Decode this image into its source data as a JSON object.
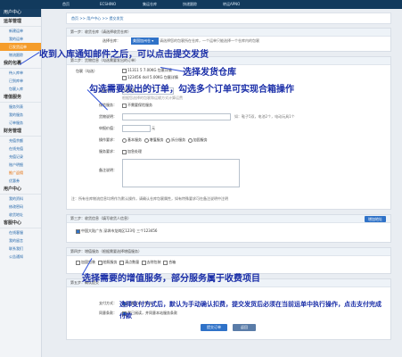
{
  "topnav": {
    "items": [
      "首页",
      "ECSHINO",
      "集运仓库",
      "快递跟踪",
      "转运APNO"
    ]
  },
  "sidebar": {
    "title": "用户中心",
    "sections": [
      {
        "name": "运单管理",
        "items": [
          "新建运单",
          "我的运单",
          "已发货运单",
          "物流跟踪"
        ]
      },
      {
        "name": "我的包裹",
        "items": [
          "待入库单",
          "已到库单",
          "包裹入库"
        ]
      },
      {
        "name": "增值服务",
        "items": [
          "服务列表",
          "我的服务",
          "订单服务"
        ]
      },
      {
        "name": "财务管理",
        "items": [
          "充值余额",
          "在线充值",
          "充值记录",
          "账户明细",
          "推广返佣",
          "优惠券"
        ]
      },
      {
        "name": "用户中心",
        "items": [
          "我的资料",
          "修改密码",
          "收货地址"
        ]
      },
      {
        "name": "客服中心",
        "items": [
          "在线客服",
          "我的留言",
          "联系我们",
          "公告通知"
        ]
      }
    ]
  },
  "breadcrumb": [
    "首页",
    "用户中心",
    "提交发货"
  ],
  "step1": {
    "header": "第一步：收货仓库（请选择收货仓库）",
    "label": "选择仓库：",
    "warehouse": "美国加州仓",
    "hint": "请选择您的包裹所在仓库，一个运单只能选择一个仓库内的包裹"
  },
  "step2": {
    "header": "第二步：货物信息（勾选需要发出的订单）",
    "package_label": "包裹（勾选）",
    "packages": [
      "11311   5   7.00KG   包裹详情",
      "123456  doll   5.00KG   包裹详情"
    ],
    "shipping_label": "运输方式：",
    "shipping_value": "请选择",
    "shipping_hint": "根据您选择的包裹和运输方式计算运费",
    "insurance_label": "保险服务：",
    "insurance_value": "不需要保险服务",
    "declare_label": "货物说明：",
    "declare_hint": "如：鞋子5双，电池2个，电动玩具1个",
    "declare_value_label": "申报价值：",
    "declare_unit": "元",
    "actions_label": "操作要求：",
    "actions": [
      "基本服务",
      "增值服务",
      "拆分服务",
      "加固服务"
    ],
    "service_label": "服务要求：",
    "service_value": "加急处理",
    "remark_label": "备注说明：",
    "footer_note": "注：所有仓库物流信息均将作为默认操作，请确认仓库包裹属性，如有特殊要求可在备注说明中注明"
  },
  "step3": {
    "header": "第三步：收货信息（填写收货人信息）",
    "button": "增加地址",
    "address": "中国大陆广东 深圳市龙岗区123号  三个123456"
  },
  "step4": {
    "header": "第四步：增值服务（根据需要选择增值服务）",
    "items": [
      "加固包装",
      "拍照服务",
      "清点数量",
      "去除包装",
      "合箱"
    ]
  },
  "step5": {
    "header": "第五步：确认提交",
    "pay_label": "支付方式：",
    "pay_value": "余额支付（默认）",
    "agree_label": "同意条款：",
    "agree_value": "我已阅读，并同意本站服务条款",
    "submit": "提交订单",
    "back": "返回"
  },
  "annotations": [
    "收到入库通知邮件之后，可以点击提交发货",
    "选择发货仓库",
    "勾选需要发出的订单，勾选多个订单可实现合箱操作",
    "选择需要的增值服务，部分服务属于收费项目",
    "选择支付方式后，默认为手动确认扣费，提交发货后必须在当前运单中执行操作，点击支付完成付款"
  ]
}
